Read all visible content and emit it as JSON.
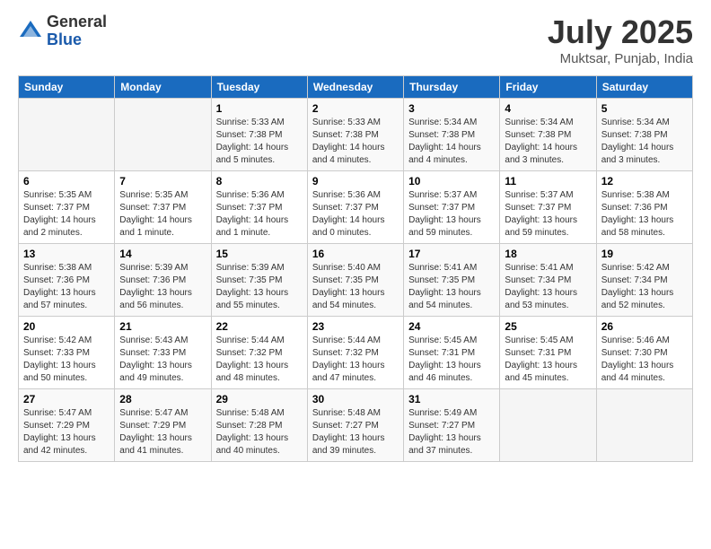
{
  "header": {
    "logo_general": "General",
    "logo_blue": "Blue",
    "month": "July 2025",
    "location": "Muktsar, Punjab, India"
  },
  "days_of_week": [
    "Sunday",
    "Monday",
    "Tuesday",
    "Wednesday",
    "Thursday",
    "Friday",
    "Saturday"
  ],
  "weeks": [
    [
      {
        "day": "",
        "detail": ""
      },
      {
        "day": "",
        "detail": ""
      },
      {
        "day": "1",
        "detail": "Sunrise: 5:33 AM\nSunset: 7:38 PM\nDaylight: 14 hours and 5 minutes."
      },
      {
        "day": "2",
        "detail": "Sunrise: 5:33 AM\nSunset: 7:38 PM\nDaylight: 14 hours and 4 minutes."
      },
      {
        "day": "3",
        "detail": "Sunrise: 5:34 AM\nSunset: 7:38 PM\nDaylight: 14 hours and 4 minutes."
      },
      {
        "day": "4",
        "detail": "Sunrise: 5:34 AM\nSunset: 7:38 PM\nDaylight: 14 hours and 3 minutes."
      },
      {
        "day": "5",
        "detail": "Sunrise: 5:34 AM\nSunset: 7:38 PM\nDaylight: 14 hours and 3 minutes."
      }
    ],
    [
      {
        "day": "6",
        "detail": "Sunrise: 5:35 AM\nSunset: 7:37 PM\nDaylight: 14 hours and 2 minutes."
      },
      {
        "day": "7",
        "detail": "Sunrise: 5:35 AM\nSunset: 7:37 PM\nDaylight: 14 hours and 1 minute."
      },
      {
        "day": "8",
        "detail": "Sunrise: 5:36 AM\nSunset: 7:37 PM\nDaylight: 14 hours and 1 minute."
      },
      {
        "day": "9",
        "detail": "Sunrise: 5:36 AM\nSunset: 7:37 PM\nDaylight: 14 hours and 0 minutes."
      },
      {
        "day": "10",
        "detail": "Sunrise: 5:37 AM\nSunset: 7:37 PM\nDaylight: 13 hours and 59 minutes."
      },
      {
        "day": "11",
        "detail": "Sunrise: 5:37 AM\nSunset: 7:37 PM\nDaylight: 13 hours and 59 minutes."
      },
      {
        "day": "12",
        "detail": "Sunrise: 5:38 AM\nSunset: 7:36 PM\nDaylight: 13 hours and 58 minutes."
      }
    ],
    [
      {
        "day": "13",
        "detail": "Sunrise: 5:38 AM\nSunset: 7:36 PM\nDaylight: 13 hours and 57 minutes."
      },
      {
        "day": "14",
        "detail": "Sunrise: 5:39 AM\nSunset: 7:36 PM\nDaylight: 13 hours and 56 minutes."
      },
      {
        "day": "15",
        "detail": "Sunrise: 5:39 AM\nSunset: 7:35 PM\nDaylight: 13 hours and 55 minutes."
      },
      {
        "day": "16",
        "detail": "Sunrise: 5:40 AM\nSunset: 7:35 PM\nDaylight: 13 hours and 54 minutes."
      },
      {
        "day": "17",
        "detail": "Sunrise: 5:41 AM\nSunset: 7:35 PM\nDaylight: 13 hours and 54 minutes."
      },
      {
        "day": "18",
        "detail": "Sunrise: 5:41 AM\nSunset: 7:34 PM\nDaylight: 13 hours and 53 minutes."
      },
      {
        "day": "19",
        "detail": "Sunrise: 5:42 AM\nSunset: 7:34 PM\nDaylight: 13 hours and 52 minutes."
      }
    ],
    [
      {
        "day": "20",
        "detail": "Sunrise: 5:42 AM\nSunset: 7:33 PM\nDaylight: 13 hours and 50 minutes."
      },
      {
        "day": "21",
        "detail": "Sunrise: 5:43 AM\nSunset: 7:33 PM\nDaylight: 13 hours and 49 minutes."
      },
      {
        "day": "22",
        "detail": "Sunrise: 5:44 AM\nSunset: 7:32 PM\nDaylight: 13 hours and 48 minutes."
      },
      {
        "day": "23",
        "detail": "Sunrise: 5:44 AM\nSunset: 7:32 PM\nDaylight: 13 hours and 47 minutes."
      },
      {
        "day": "24",
        "detail": "Sunrise: 5:45 AM\nSunset: 7:31 PM\nDaylight: 13 hours and 46 minutes."
      },
      {
        "day": "25",
        "detail": "Sunrise: 5:45 AM\nSunset: 7:31 PM\nDaylight: 13 hours and 45 minutes."
      },
      {
        "day": "26",
        "detail": "Sunrise: 5:46 AM\nSunset: 7:30 PM\nDaylight: 13 hours and 44 minutes."
      }
    ],
    [
      {
        "day": "27",
        "detail": "Sunrise: 5:47 AM\nSunset: 7:29 PM\nDaylight: 13 hours and 42 minutes."
      },
      {
        "day": "28",
        "detail": "Sunrise: 5:47 AM\nSunset: 7:29 PM\nDaylight: 13 hours and 41 minutes."
      },
      {
        "day": "29",
        "detail": "Sunrise: 5:48 AM\nSunset: 7:28 PM\nDaylight: 13 hours and 40 minutes."
      },
      {
        "day": "30",
        "detail": "Sunrise: 5:48 AM\nSunset: 7:27 PM\nDaylight: 13 hours and 39 minutes."
      },
      {
        "day": "31",
        "detail": "Sunrise: 5:49 AM\nSunset: 7:27 PM\nDaylight: 13 hours and 37 minutes."
      },
      {
        "day": "",
        "detail": ""
      },
      {
        "day": "",
        "detail": ""
      }
    ]
  ]
}
